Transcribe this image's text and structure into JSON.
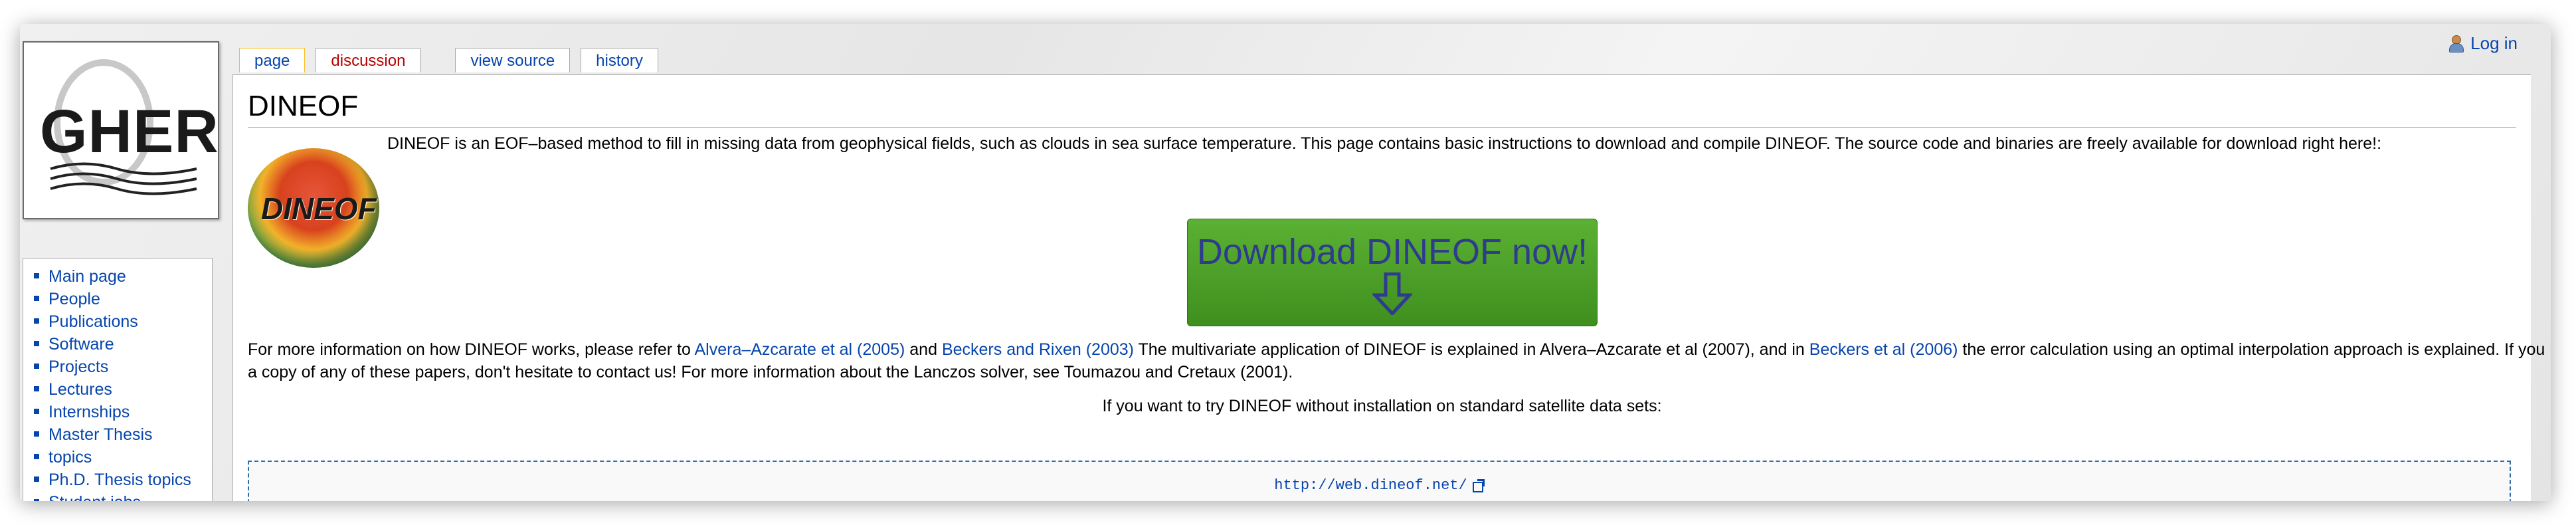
{
  "header": {
    "login_label": "Log in"
  },
  "logo": {
    "text": "GHER"
  },
  "tabs": [
    {
      "label": "page"
    },
    {
      "label": "discussion"
    },
    {
      "label": "view source"
    },
    {
      "label": "history"
    }
  ],
  "sidebar": {
    "items": [
      {
        "label": "Main page"
      },
      {
        "label": "People"
      },
      {
        "label": "Publications"
      },
      {
        "label": "Software"
      },
      {
        "label": "Projects"
      },
      {
        "label": "Lectures"
      },
      {
        "label": "Internships"
      },
      {
        "label": "Master Thesis"
      },
      {
        "label": "topics"
      },
      {
        "label": "Ph.D. Thesis topics"
      },
      {
        "label": "Student jobs"
      }
    ]
  },
  "page": {
    "title": "DINEOF",
    "dineof_logo_text": "DINEOF",
    "intro": "DINEOF is an EOF–based method to fill in missing data from geophysical fields, such as clouds in sea surface temperature. This page contains basic instructions to download and compile DINEOF. The source code and binaries are freely available for download right here!:",
    "download_label": "Download DINEOF now!",
    "para_1": "For more information on how DINEOF works, please refer to ",
    "link_1": "Alvera–Azcarate et al (2005)",
    "para_2": " and ",
    "link_2": "Beckers and Rixen (2003)",
    "para_3": " The multivariate application of DINEOF is explained in Alvera–Azcarate et al (2007), and in ",
    "link_3": "Beckers et al (2006)",
    "para_4": " the error calculation using an optimal interpolation approach is explained. If you need a copy of any of these papers, don't hesitate to contact us! For more information about the Lanczos solver, see Toumazou and Cretaux (2001).",
    "center_line": "If you want to try DINEOF without installation on standard satellite data sets:",
    "url": "http://web.dineof.net/"
  }
}
